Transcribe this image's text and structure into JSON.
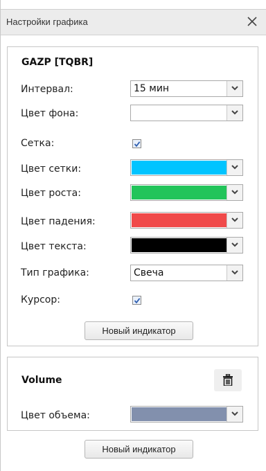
{
  "window": {
    "title": "Настройки графика"
  },
  "panel": {
    "title": "GAZP [TQBR]",
    "rows": {
      "interval": {
        "label": "Интервал:",
        "value": "15 мин"
      },
      "bg_color": {
        "label": "Цвет фона:",
        "color": "#ffffff"
      },
      "grid": {
        "label": "Сетка:",
        "checked": true
      },
      "grid_color": {
        "label": "Цвет сетки:",
        "color": "#00c4ff"
      },
      "up_color": {
        "label": "Цвет роста:",
        "color": "#22c45a"
      },
      "down_color": {
        "label": "Цвет падения:",
        "color": "#f04a4a"
      },
      "text_color": {
        "label": "Цвет текста:",
        "color": "#000000"
      },
      "chart_type": {
        "label": "Тип графика:",
        "value": "Свеча"
      },
      "cursor": {
        "label": "Курсор:",
        "checked": true
      }
    },
    "new_indicator_label": "Новый индикатор"
  },
  "volume_panel": {
    "title": "Volume",
    "color_label": "Цвет объема:",
    "color": "#8290ad"
  },
  "footer": {
    "new_indicator_label": "Новый индикатор"
  },
  "icons": {
    "close": "close-icon",
    "dropdown": "chevron-down-icon",
    "check": "check-icon",
    "trash": "trash-icon"
  }
}
